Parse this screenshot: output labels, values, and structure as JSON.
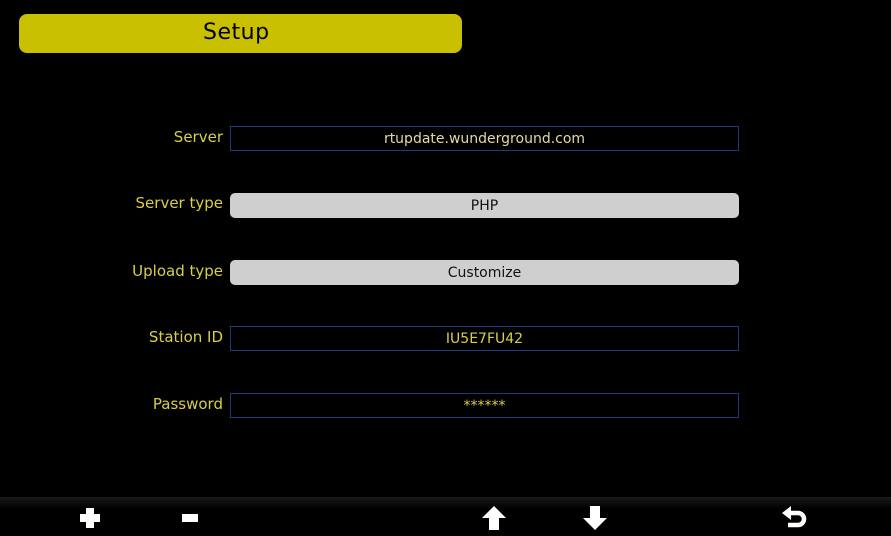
{
  "header": {
    "title": "Setup"
  },
  "form": {
    "server": {
      "label": "Server",
      "value": "rtupdate.wunderground.com"
    },
    "server_type": {
      "label": "Server type",
      "value": "PHP"
    },
    "upload_type": {
      "label": "Upload type",
      "value": "Customize"
    },
    "station_id": {
      "label": "Station ID",
      "value": "IU5E7FU42"
    },
    "password": {
      "label": "Password",
      "value": "******"
    }
  },
  "toolbar": {
    "buttons": [
      {
        "icon": "plus-icon"
      },
      {
        "icon": "minus-icon"
      },
      {
        "icon": "arrow-up-icon"
      },
      {
        "icon": "arrow-down-icon"
      },
      {
        "icon": "return-icon"
      }
    ]
  },
  "colors": {
    "title_tab": "#c8c000",
    "label_text": "#d8cf48",
    "field_border": "#1d3a7a",
    "select_bg": "#cfcfcf",
    "background": "#000000"
  }
}
